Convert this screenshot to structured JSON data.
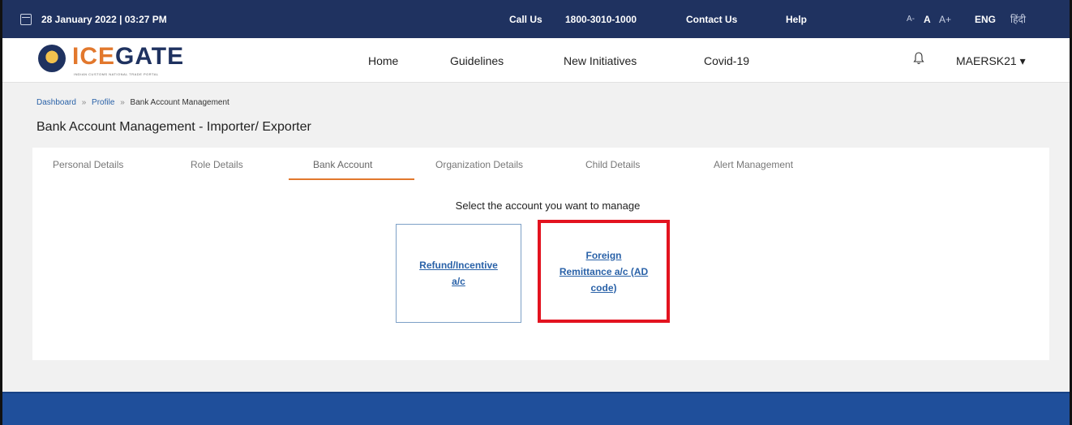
{
  "topbar": {
    "datetime": "28 January 2022 | 03:27 PM",
    "call_label": "Call Us",
    "phone": "1800-3010-1000",
    "contact": "Contact Us",
    "help": "Help",
    "font_small": "A-",
    "font_normal": "A",
    "font_large": "A+",
    "lang_eng": "ENG",
    "lang_hindi": "हिंदी"
  },
  "nav": {
    "logo_text_a": "ICE",
    "logo_text_b": "GATE",
    "logo_sub": "INDIAN CUSTOMS NATIONAL TRADE PORTAL",
    "home": "Home",
    "guidelines": "Guidelines",
    "new_initiatives": "New Initiatives",
    "covid": "Covid-19",
    "user": "MAERSK21 ▾"
  },
  "breadcrumb": {
    "dashboard": "Dashboard",
    "profile": "Profile",
    "current": "Bank Account Management",
    "sep": "»"
  },
  "page_title": "Bank Account Management - Importer/ Exporter",
  "tabs": [
    {
      "label": "Personal Details"
    },
    {
      "label": "Role Details"
    },
    {
      "label": "Bank Account"
    },
    {
      "label": "Organization Details"
    },
    {
      "label": "Child Details"
    },
    {
      "label": "Alert Management"
    }
  ],
  "active_tab": "Bank Account",
  "prompt": "Select the account you want to manage",
  "accounts": {
    "refund": "Refund/Incentive a/c",
    "foreign": "Foreign Remittance a/c (AD code)"
  },
  "colors": {
    "header_bg": "#1f3260",
    "accent_orange": "#e2782d",
    "link_blue": "#2a62a8",
    "highlight_red": "#e3131f",
    "footer_bg": "#1f4f9b"
  }
}
